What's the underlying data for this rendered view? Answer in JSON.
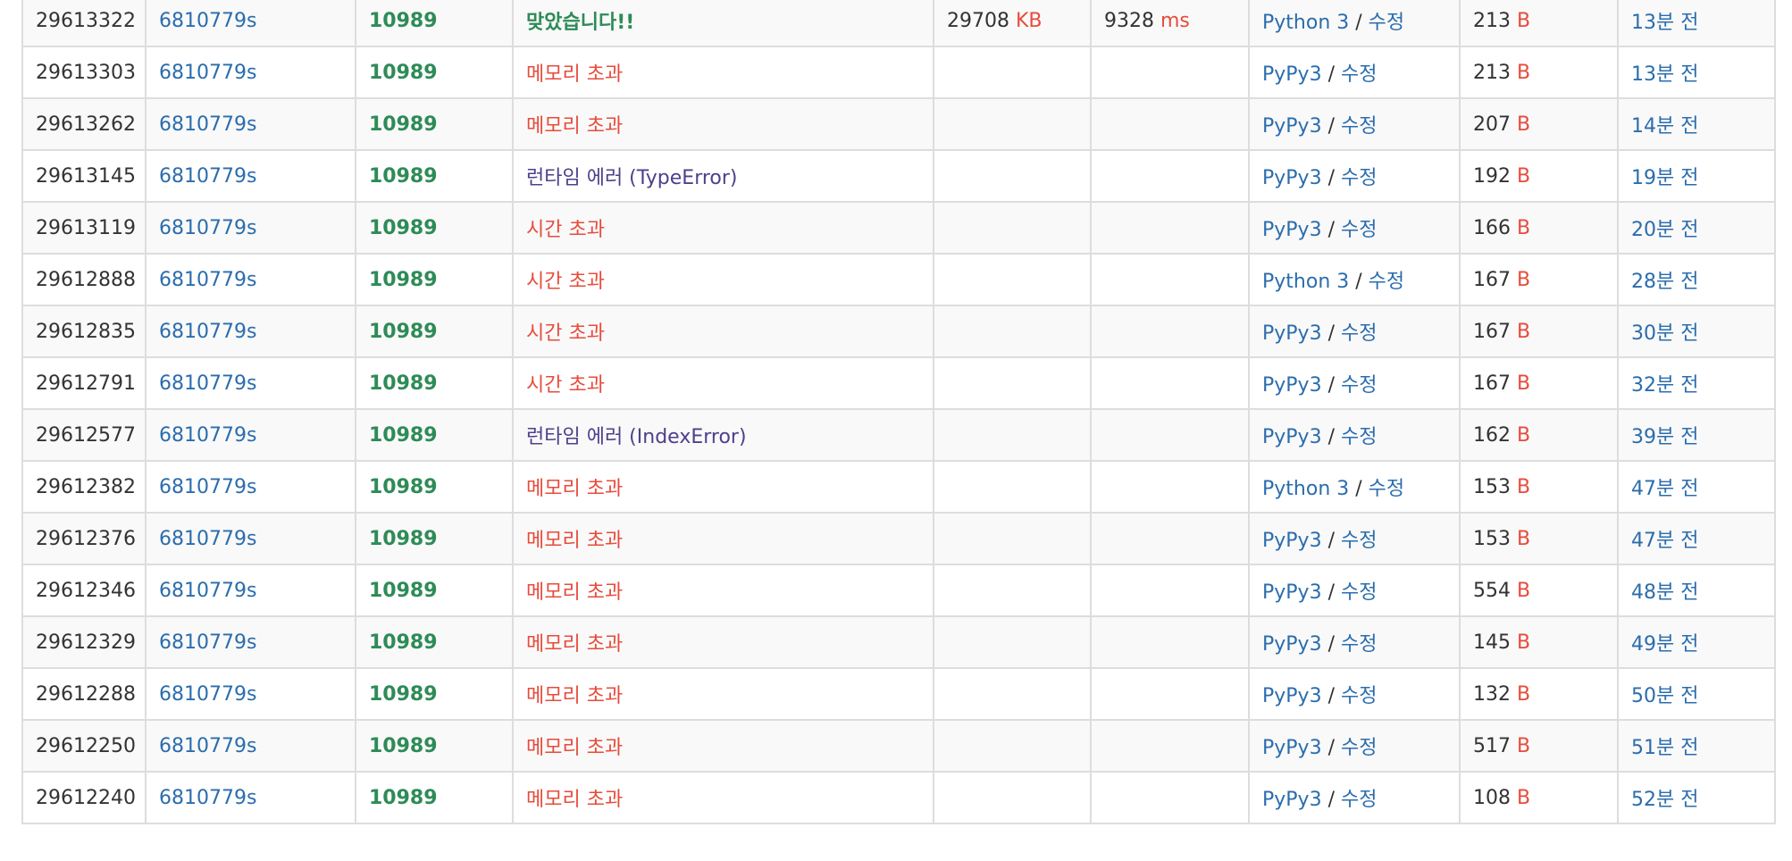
{
  "colors": {
    "link": "#2b6dad",
    "accepted": "#2e8b57",
    "error": "#e74c3c",
    "runtime_error": "#4f3f8c",
    "border": "#dddddd",
    "stripe": "#f9f9f9"
  },
  "edit_label": "수정",
  "rows": [
    {
      "id": "29613322",
      "user": "6810779s",
      "problem": "10989",
      "result": "맞았습니다!!",
      "result_type": "ac",
      "memory": "29708",
      "memory_unit": "KB",
      "time": "9328",
      "time_unit": "ms",
      "language": "Python 3",
      "edit": "수정",
      "length": "213",
      "length_unit": "B",
      "submitted": "13분 전"
    },
    {
      "id": "29613303",
      "user": "6810779s",
      "problem": "10989",
      "result": "메모리 초과",
      "result_type": "mle",
      "memory": "",
      "memory_unit": "",
      "time": "",
      "time_unit": "",
      "language": "PyPy3",
      "edit": "수정",
      "length": "213",
      "length_unit": "B",
      "submitted": "13분 전"
    },
    {
      "id": "29613262",
      "user": "6810779s",
      "problem": "10989",
      "result": "메모리 초과",
      "result_type": "mle",
      "memory": "",
      "memory_unit": "",
      "time": "",
      "time_unit": "",
      "language": "PyPy3",
      "edit": "수정",
      "length": "207",
      "length_unit": "B",
      "submitted": "14분 전"
    },
    {
      "id": "29613145",
      "user": "6810779s",
      "problem": "10989",
      "result": "런타임 에러 (TypeError)",
      "result_type": "rte",
      "memory": "",
      "memory_unit": "",
      "time": "",
      "time_unit": "",
      "language": "PyPy3",
      "edit": "수정",
      "length": "192",
      "length_unit": "B",
      "submitted": "19분 전"
    },
    {
      "id": "29613119",
      "user": "6810779s",
      "problem": "10989",
      "result": "시간 초과",
      "result_type": "tle",
      "memory": "",
      "memory_unit": "",
      "time": "",
      "time_unit": "",
      "language": "PyPy3",
      "edit": "수정",
      "length": "166",
      "length_unit": "B",
      "submitted": "20분 전"
    },
    {
      "id": "29612888",
      "user": "6810779s",
      "problem": "10989",
      "result": "시간 초과",
      "result_type": "tle",
      "memory": "",
      "memory_unit": "",
      "time": "",
      "time_unit": "",
      "language": "Python 3",
      "edit": "수정",
      "length": "167",
      "length_unit": "B",
      "submitted": "28분 전"
    },
    {
      "id": "29612835",
      "user": "6810779s",
      "problem": "10989",
      "result": "시간 초과",
      "result_type": "tle",
      "memory": "",
      "memory_unit": "",
      "time": "",
      "time_unit": "",
      "language": "PyPy3",
      "edit": "수정",
      "length": "167",
      "length_unit": "B",
      "submitted": "30분 전"
    },
    {
      "id": "29612791",
      "user": "6810779s",
      "problem": "10989",
      "result": "시간 초과",
      "result_type": "tle",
      "memory": "",
      "memory_unit": "",
      "time": "",
      "time_unit": "",
      "language": "PyPy3",
      "edit": "수정",
      "length": "167",
      "length_unit": "B",
      "submitted": "32분 전"
    },
    {
      "id": "29612577",
      "user": "6810779s",
      "problem": "10989",
      "result": "런타임 에러 (IndexError)",
      "result_type": "rte",
      "memory": "",
      "memory_unit": "",
      "time": "",
      "time_unit": "",
      "language": "PyPy3",
      "edit": "수정",
      "length": "162",
      "length_unit": "B",
      "submitted": "39분 전"
    },
    {
      "id": "29612382",
      "user": "6810779s",
      "problem": "10989",
      "result": "메모리 초과",
      "result_type": "mle",
      "memory": "",
      "memory_unit": "",
      "time": "",
      "time_unit": "",
      "language": "Python 3",
      "edit": "수정",
      "length": "153",
      "length_unit": "B",
      "submitted": "47분 전"
    },
    {
      "id": "29612376",
      "user": "6810779s",
      "problem": "10989",
      "result": "메모리 초과",
      "result_type": "mle",
      "memory": "",
      "memory_unit": "",
      "time": "",
      "time_unit": "",
      "language": "PyPy3",
      "edit": "수정",
      "length": "153",
      "length_unit": "B",
      "submitted": "47분 전"
    },
    {
      "id": "29612346",
      "user": "6810779s",
      "problem": "10989",
      "result": "메모리 초과",
      "result_type": "mle",
      "memory": "",
      "memory_unit": "",
      "time": "",
      "time_unit": "",
      "language": "PyPy3",
      "edit": "수정",
      "length": "554",
      "length_unit": "B",
      "submitted": "48분 전"
    },
    {
      "id": "29612329",
      "user": "6810779s",
      "problem": "10989",
      "result": "메모리 초과",
      "result_type": "mle",
      "memory": "",
      "memory_unit": "",
      "time": "",
      "time_unit": "",
      "language": "PyPy3",
      "edit": "수정",
      "length": "145",
      "length_unit": "B",
      "submitted": "49분 전"
    },
    {
      "id": "29612288",
      "user": "6810779s",
      "problem": "10989",
      "result": "메모리 초과",
      "result_type": "mle",
      "memory": "",
      "memory_unit": "",
      "time": "",
      "time_unit": "",
      "language": "PyPy3",
      "edit": "수정",
      "length": "132",
      "length_unit": "B",
      "submitted": "50분 전"
    },
    {
      "id": "29612250",
      "user": "6810779s",
      "problem": "10989",
      "result": "메모리 초과",
      "result_type": "mle",
      "memory": "",
      "memory_unit": "",
      "time": "",
      "time_unit": "",
      "language": "PyPy3",
      "edit": "수정",
      "length": "517",
      "length_unit": "B",
      "submitted": "51분 전"
    },
    {
      "id": "29612240",
      "user": "6810779s",
      "problem": "10989",
      "result": "메모리 초과",
      "result_type": "mle",
      "memory": "",
      "memory_unit": "",
      "time": "",
      "time_unit": "",
      "language": "PyPy3",
      "edit": "수정",
      "length": "108",
      "length_unit": "B",
      "submitted": "52분 전"
    }
  ]
}
